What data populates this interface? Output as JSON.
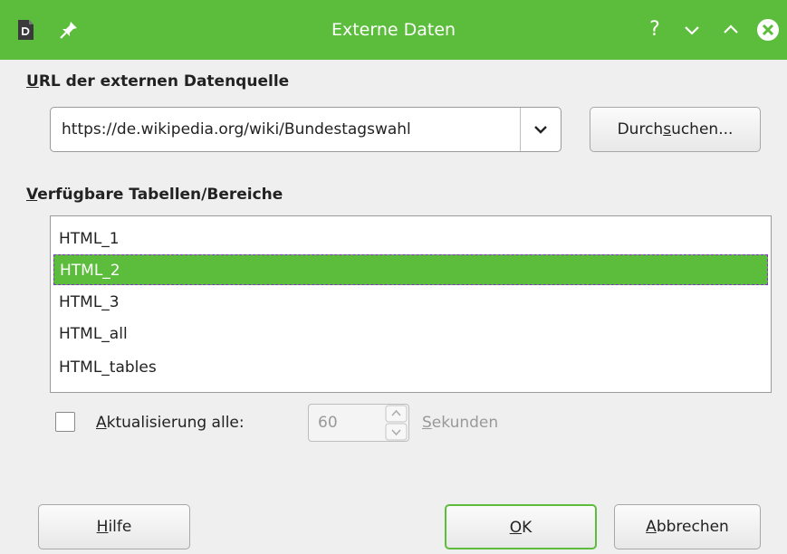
{
  "window": {
    "title": "Externe Daten",
    "help_symbol": "?",
    "accent_color": "#5cbd3c",
    "icons": [
      "document-icon",
      "pin-icon",
      "help-icon",
      "minimize-icon",
      "maximize-icon",
      "close-icon"
    ]
  },
  "url_section": {
    "heading_mnemonic": "U",
    "heading_rest": "RL der externen Datenquelle",
    "url_value": "https://de.wikipedia.org/wiki/Bundestagswahl",
    "browse_pre": "Durch",
    "browse_mnemonic": "s",
    "browse_post": "uchen..."
  },
  "tables_section": {
    "heading_mnemonic": "V",
    "heading_rest": "erfügbare Tabellen/Bereiche",
    "items": [
      "HTML_1",
      "HTML_2",
      "HTML_3",
      "HTML_all",
      "HTML_tables"
    ],
    "selected_item": "HTML_2"
  },
  "update": {
    "checked": false,
    "label_mnemonic": "A",
    "label_rest": "ktualisierung alle:",
    "interval_value": "60",
    "unit_mnemonic": "S",
    "unit_rest": "ekunden"
  },
  "buttons": {
    "help_mnemonic": "H",
    "help_rest": "ilfe",
    "ok_mnemonic": "O",
    "ok_rest": "K",
    "cancel_mnemonic": "A",
    "cancel_rest": "bbrechen"
  }
}
